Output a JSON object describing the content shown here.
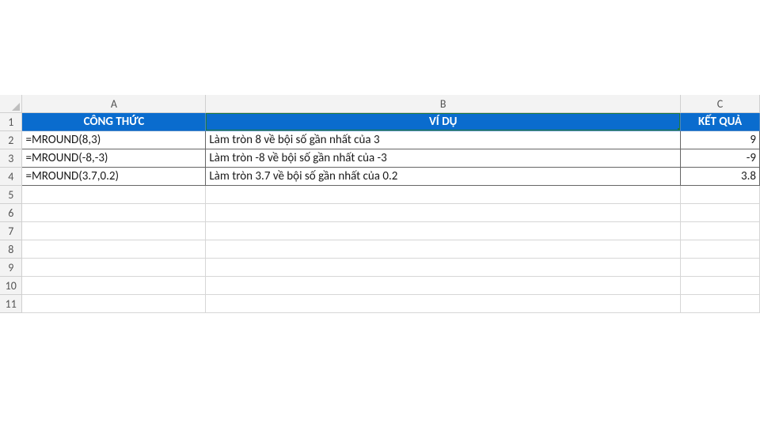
{
  "columns": {
    "A": "A",
    "B": "B",
    "C": "C"
  },
  "rowLabels": {
    "r1": "1",
    "r2": "2",
    "r3": "3",
    "r4": "4",
    "r5": "5",
    "r6": "6",
    "r7": "7",
    "r8": "8",
    "r9": "9",
    "r10": "10",
    "r11": "11"
  },
  "header": {
    "A": "CÔNG THỨC",
    "B": "VÍ DỤ",
    "C": "KẾT QUẢ"
  },
  "rows": [
    {
      "formula": "=MROUND(8,3)",
      "desc": "Làm tròn 8 về bội số gần nhất của 3",
      "result": "9"
    },
    {
      "formula": "=MROUND(-8,-3)",
      "desc": "Làm tròn -8 về bội số gần nhất của -3",
      "result": "-9"
    },
    {
      "formula": "=MROUND(3.7,0.2)",
      "desc": "Làm tròn 3.7 về bội số gần nhất của 0.2",
      "result": "3.8"
    }
  ],
  "chart_data": {
    "type": "table",
    "columns": [
      "CÔNG THỨC",
      "VÍ DỤ",
      "KẾT QUẢ"
    ],
    "rows": [
      [
        "=MROUND(8,3)",
        "Làm tròn 8 về bội số gần nhất của 3",
        9
      ],
      [
        "=MROUND(-8,-3)",
        "Làm tròn -8 về bội số gần nhất của -3",
        -9
      ],
      [
        "=MROUND(3.7,0.2)",
        "Làm tròn 3.7 về bội số gần nhất của 0.2",
        3.8
      ]
    ]
  }
}
